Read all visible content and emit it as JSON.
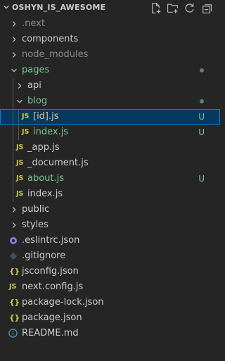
{
  "explorer": {
    "title": "OSHYN_IS_AWESOME",
    "actions": [
      "new-file-icon",
      "new-folder-icon",
      "refresh-icon",
      "collapse-all-icon"
    ],
    "colors": {
      "background": "#252526",
      "selected_bg": "#04395e",
      "selected_border": "#007fd4",
      "untracked_green": "#73c991",
      "ignored_gray": "#8b8b8b",
      "js_yellow": "#cbcb41"
    }
  },
  "tree": [
    {
      "label": ".next",
      "type": "folder",
      "expanded": false,
      "status": "ignored"
    },
    {
      "label": "components",
      "type": "folder",
      "expanded": false
    },
    {
      "label": "node_modules",
      "type": "folder",
      "expanded": false,
      "status": "ignored"
    },
    {
      "label": "pages",
      "type": "folder",
      "expanded": true,
      "status": "untracked",
      "decoration": "dot"
    },
    {
      "label": "api",
      "type": "folder",
      "expanded": false
    },
    {
      "label": "blog",
      "type": "folder",
      "expanded": true,
      "status": "untracked",
      "decoration": "dot"
    },
    {
      "label": "[id].js",
      "type": "file",
      "icon": "JS",
      "selected": true,
      "badge": "U"
    },
    {
      "label": "index.js",
      "type": "file",
      "icon": "JS",
      "status": "untracked",
      "badge": "U"
    },
    {
      "label": "_app.js",
      "type": "file",
      "icon": "JS"
    },
    {
      "label": "_document.js",
      "type": "file",
      "icon": "JS"
    },
    {
      "label": "about.js",
      "type": "file",
      "icon": "JS",
      "status": "untracked",
      "badge": "U"
    },
    {
      "label": "index.js",
      "type": "file",
      "icon": "JS"
    },
    {
      "label": "public",
      "type": "folder",
      "expanded": false
    },
    {
      "label": "styles",
      "type": "folder",
      "expanded": false
    },
    {
      "label": ".eslintrc.json",
      "type": "file",
      "icon": "eslint-icon"
    },
    {
      "label": ".gitignore",
      "type": "file",
      "icon": "git-icon"
    },
    {
      "label": "jsconfig.json",
      "type": "file",
      "icon": "{}"
    },
    {
      "label": "next.config.js",
      "type": "file",
      "icon": "JS"
    },
    {
      "label": "package-lock.json",
      "type": "file",
      "icon": "{}"
    },
    {
      "label": "package.json",
      "type": "file",
      "icon": "{}"
    },
    {
      "label": "README.md",
      "type": "file",
      "icon": "info-icon"
    }
  ]
}
